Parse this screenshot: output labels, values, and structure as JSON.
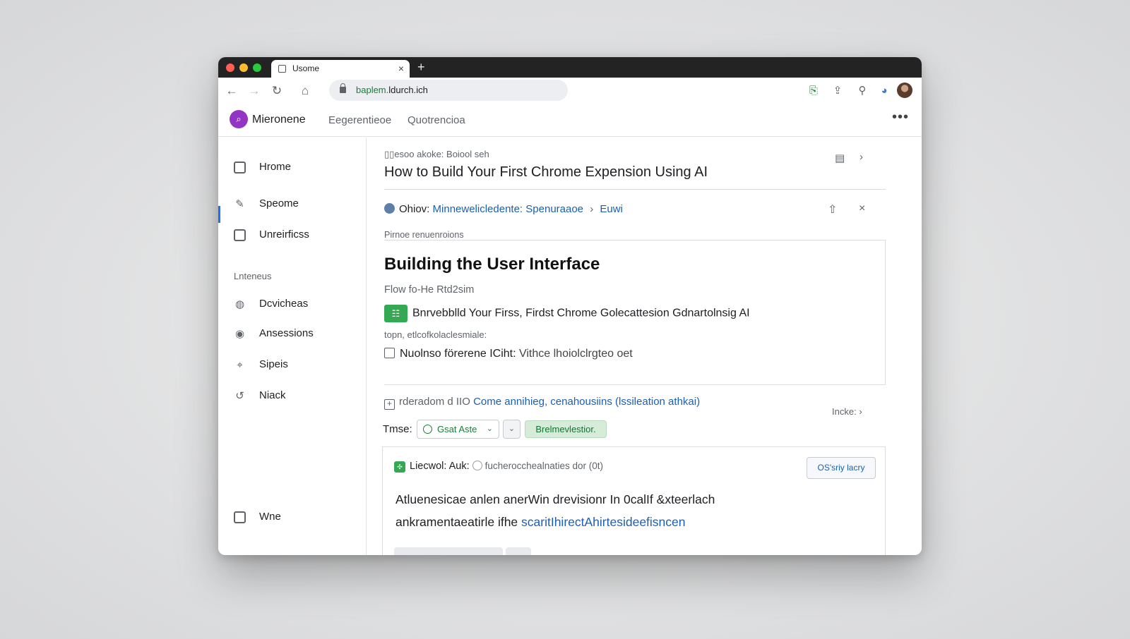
{
  "browser": {
    "tab_title": "Usome",
    "url": "baplem.ldurch.ich",
    "url_green_part": "baplem.",
    "url_rest": "ldurch.ich"
  },
  "app": {
    "brand": "Mieronene",
    "nav": [
      "Eegerentieoe",
      "Quotrencioa"
    ],
    "colors": {
      "brand": "#9334c4",
      "accent": "#1a73e8",
      "green": "#34a853",
      "link": "#1a5fb4"
    }
  },
  "sidebar": {
    "items": [
      {
        "label": "Hrome",
        "icon": "calendar-icon"
      },
      {
        "label": "Speome",
        "icon": "edit-icon"
      },
      {
        "label": "Unreirficss",
        "icon": "square-icon"
      }
    ],
    "section_label": "Lnteneus",
    "section_items": [
      {
        "label": "Dcvicheas",
        "icon": "globe-icon"
      },
      {
        "label": "Ansessions",
        "icon": "grammarly-icon"
      },
      {
        "label": "Sipeis",
        "icon": "chat-icon"
      },
      {
        "label": "Niack",
        "icon": "refresh-icon"
      }
    ],
    "bottom_item": {
      "label": "Wne",
      "icon": "profile-icon"
    }
  },
  "main": {
    "breadcrumb": "▯▯esoo akoke: Boiool seh",
    "title": "How to Build Your First Chrome Expension Using AI",
    "meta": {
      "prefix": "Ohiov:",
      "link1": "Minnewelicledente:",
      "link2": "Spenuraaoe",
      "link3": "Euwi"
    },
    "section_caption": "Pirnoe renuenroions",
    "card": {
      "heading": "Building the User Interface",
      "subheading": "Flow fo-He Rtd2sim",
      "badge": "E̲E",
      "line1": "Bnrvebblld Your Firss, Firdst Chrome Golecattesion Gdnartolnsig AI",
      "line2": "topn,  etlcofkolaclesmiale:",
      "line3_bold": "Nuolnso förerene ICiht:",
      "line3_rest": "Vithce lhoiolclrgteo oet"
    },
    "expand": {
      "prefix": "rderadom d IIO",
      "link": "Come annihieg, cenahousiins (lssileation athkai)"
    },
    "inspect_label": "Incke:",
    "type_row": {
      "label": "Tmse:",
      "select_value": "Gsat Aste",
      "pill": "Brelmevlestior."
    },
    "result": {
      "head_bold": "Liecwol: Auk:",
      "head_muted": "fucherocchealnaties dor (0t)",
      "button": "OS'sriy lacry",
      "para1": "Atluenesicae anlen anerWin drevisionr In 0calIf &xteerlach",
      "para2_text": "ankramentaeatirle ifhe ",
      "para2_link": "scaritIhirectAhirtesideefisncen"
    }
  }
}
